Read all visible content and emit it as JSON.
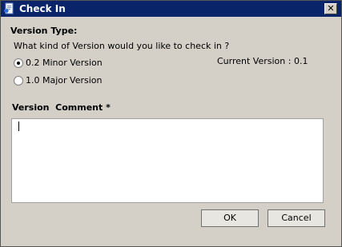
{
  "window": {
    "title": "Check In",
    "close_symbol": "✕"
  },
  "version_type": {
    "heading": "Version Type:",
    "question": "What kind of Version would you like to check in ?",
    "current_version_text": "Current Version : 0.1",
    "options": [
      {
        "label": "0.2 Minor Version",
        "selected": true
      },
      {
        "label": "1.0 Major Version",
        "selected": false
      }
    ]
  },
  "comment": {
    "label": "Version  Comment *",
    "value": ""
  },
  "buttons": {
    "ok": "OK",
    "cancel": "Cancel"
  },
  "icons": {
    "title_icon": "document-checkin-icon"
  }
}
